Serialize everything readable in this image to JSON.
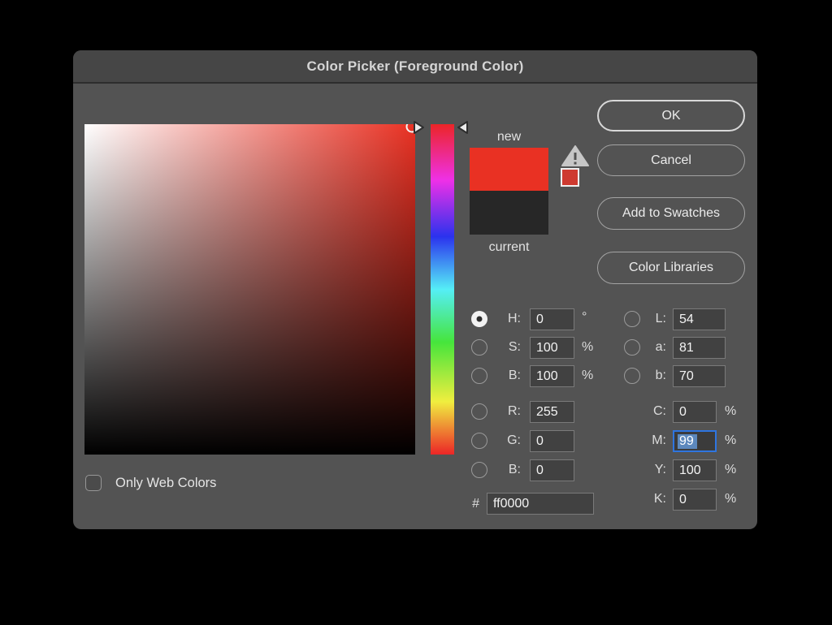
{
  "window": {
    "title": "Color Picker (Foreground Color)"
  },
  "buttons": {
    "ok": "OK",
    "cancel": "Cancel",
    "add_to_swatches": "Add to Swatches",
    "color_libraries": "Color Libraries"
  },
  "swatch": {
    "new_label": "new",
    "current_label": "current",
    "new_color": "#e93123",
    "current_color": "#272727"
  },
  "fields": {
    "h": {
      "label": "H:",
      "value": "0",
      "unit": "°"
    },
    "s": {
      "label": "S:",
      "value": "100",
      "unit": "%"
    },
    "b_hsb": {
      "label": "B:",
      "value": "100",
      "unit": "%"
    },
    "r": {
      "label": "R:",
      "value": "255"
    },
    "g": {
      "label": "G:",
      "value": "0"
    },
    "b_rgb": {
      "label": "B:",
      "value": "0"
    },
    "l": {
      "label": "L:",
      "value": "54"
    },
    "a": {
      "label": "a:",
      "value": "81"
    },
    "b_lab": {
      "label": "b:",
      "value": "70"
    },
    "c": {
      "label": "C:",
      "value": "0",
      "unit": "%"
    },
    "m": {
      "label": "M:",
      "value": "99",
      "unit": "%"
    },
    "y": {
      "label": "Y:",
      "value": "100",
      "unit": "%"
    },
    "k": {
      "label": "K:",
      "value": "0",
      "unit": "%"
    },
    "hex": {
      "prefix": "#",
      "value": "ff0000"
    }
  },
  "checkbox": {
    "label": "Only Web Colors",
    "checked": false
  },
  "colors": {
    "dialog_bg": "#535353",
    "titlebar_bg": "#464646",
    "focus_border": "#2e75e0",
    "text_selection": "#5c88bc"
  }
}
